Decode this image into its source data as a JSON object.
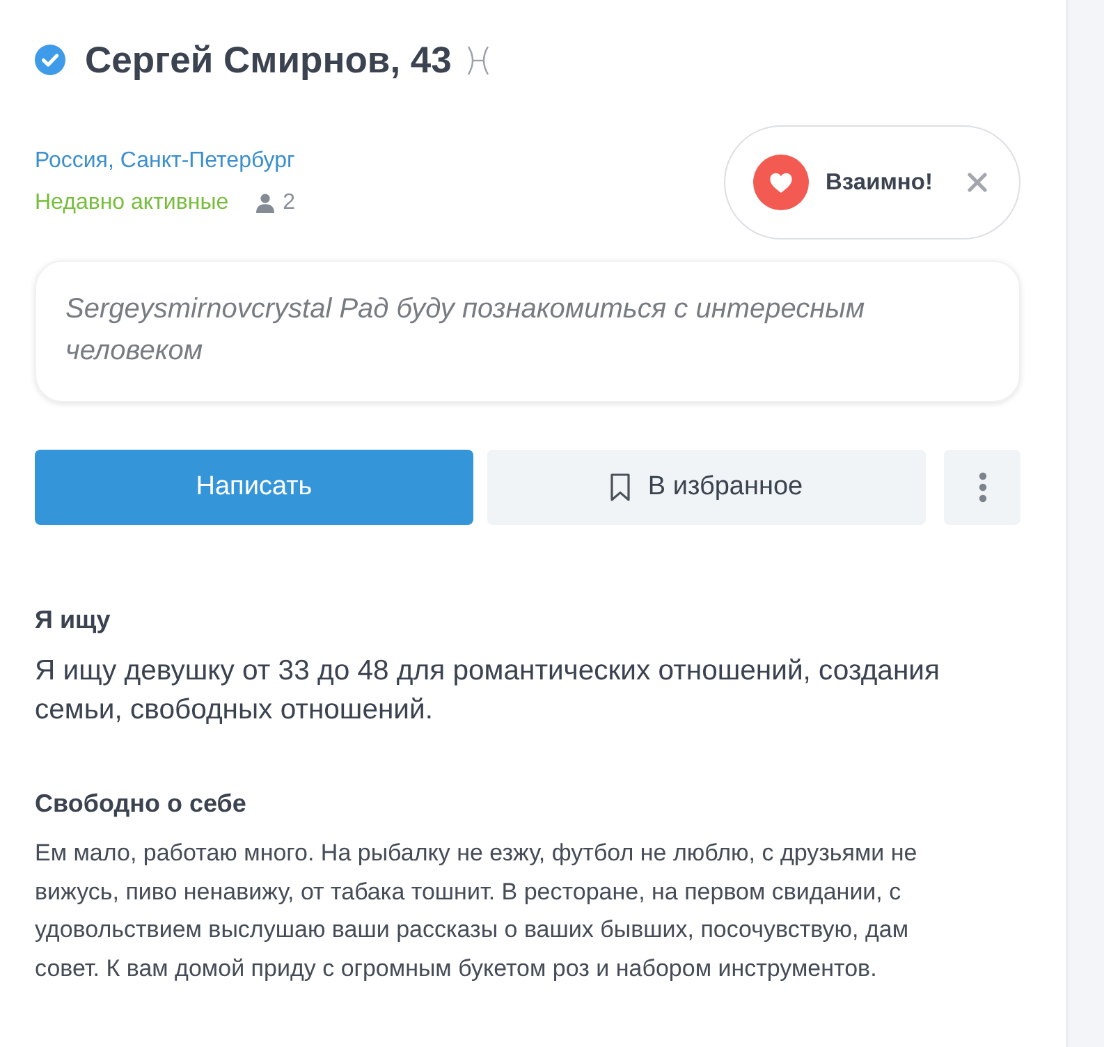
{
  "profile": {
    "verified": true,
    "name_age": "Сергей Смирнов, 43",
    "location": "Россия, Санкт-Петербург",
    "activity": "Недавно активные",
    "person_count": "2"
  },
  "match_badge": {
    "label": "Взаимно!"
  },
  "status_message": "Sergeysmirnovcrystal Рад буду познакомиться с интересным человеком",
  "actions": [
    {
      "kind": "primary",
      "label": "Написать"
    },
    {
      "kind": "bookmark",
      "label": "В избранное"
    },
    {
      "kind": "more"
    }
  ],
  "sections": [
    {
      "kind": "lead",
      "title": "Я ищу",
      "text": "Я ищу девушку от 33 до 48 для романтических отношений, создания семьи, свободных отношений."
    },
    {
      "kind": "body",
      "title": "Свободно о себе",
      "text": "Ем мало, работаю много. На рыбалку не езжу, футбол не люблю, с друзьями не вижусь, пиво ненавижу, от табака тошнит. В ресторане, на первом свидании, с удовольствием выслушаю ваши рассказы о ваших бывших, посочувствую, дам совет. К вам домой приду с огромным букетом роз и набором инструментов."
    }
  ]
}
